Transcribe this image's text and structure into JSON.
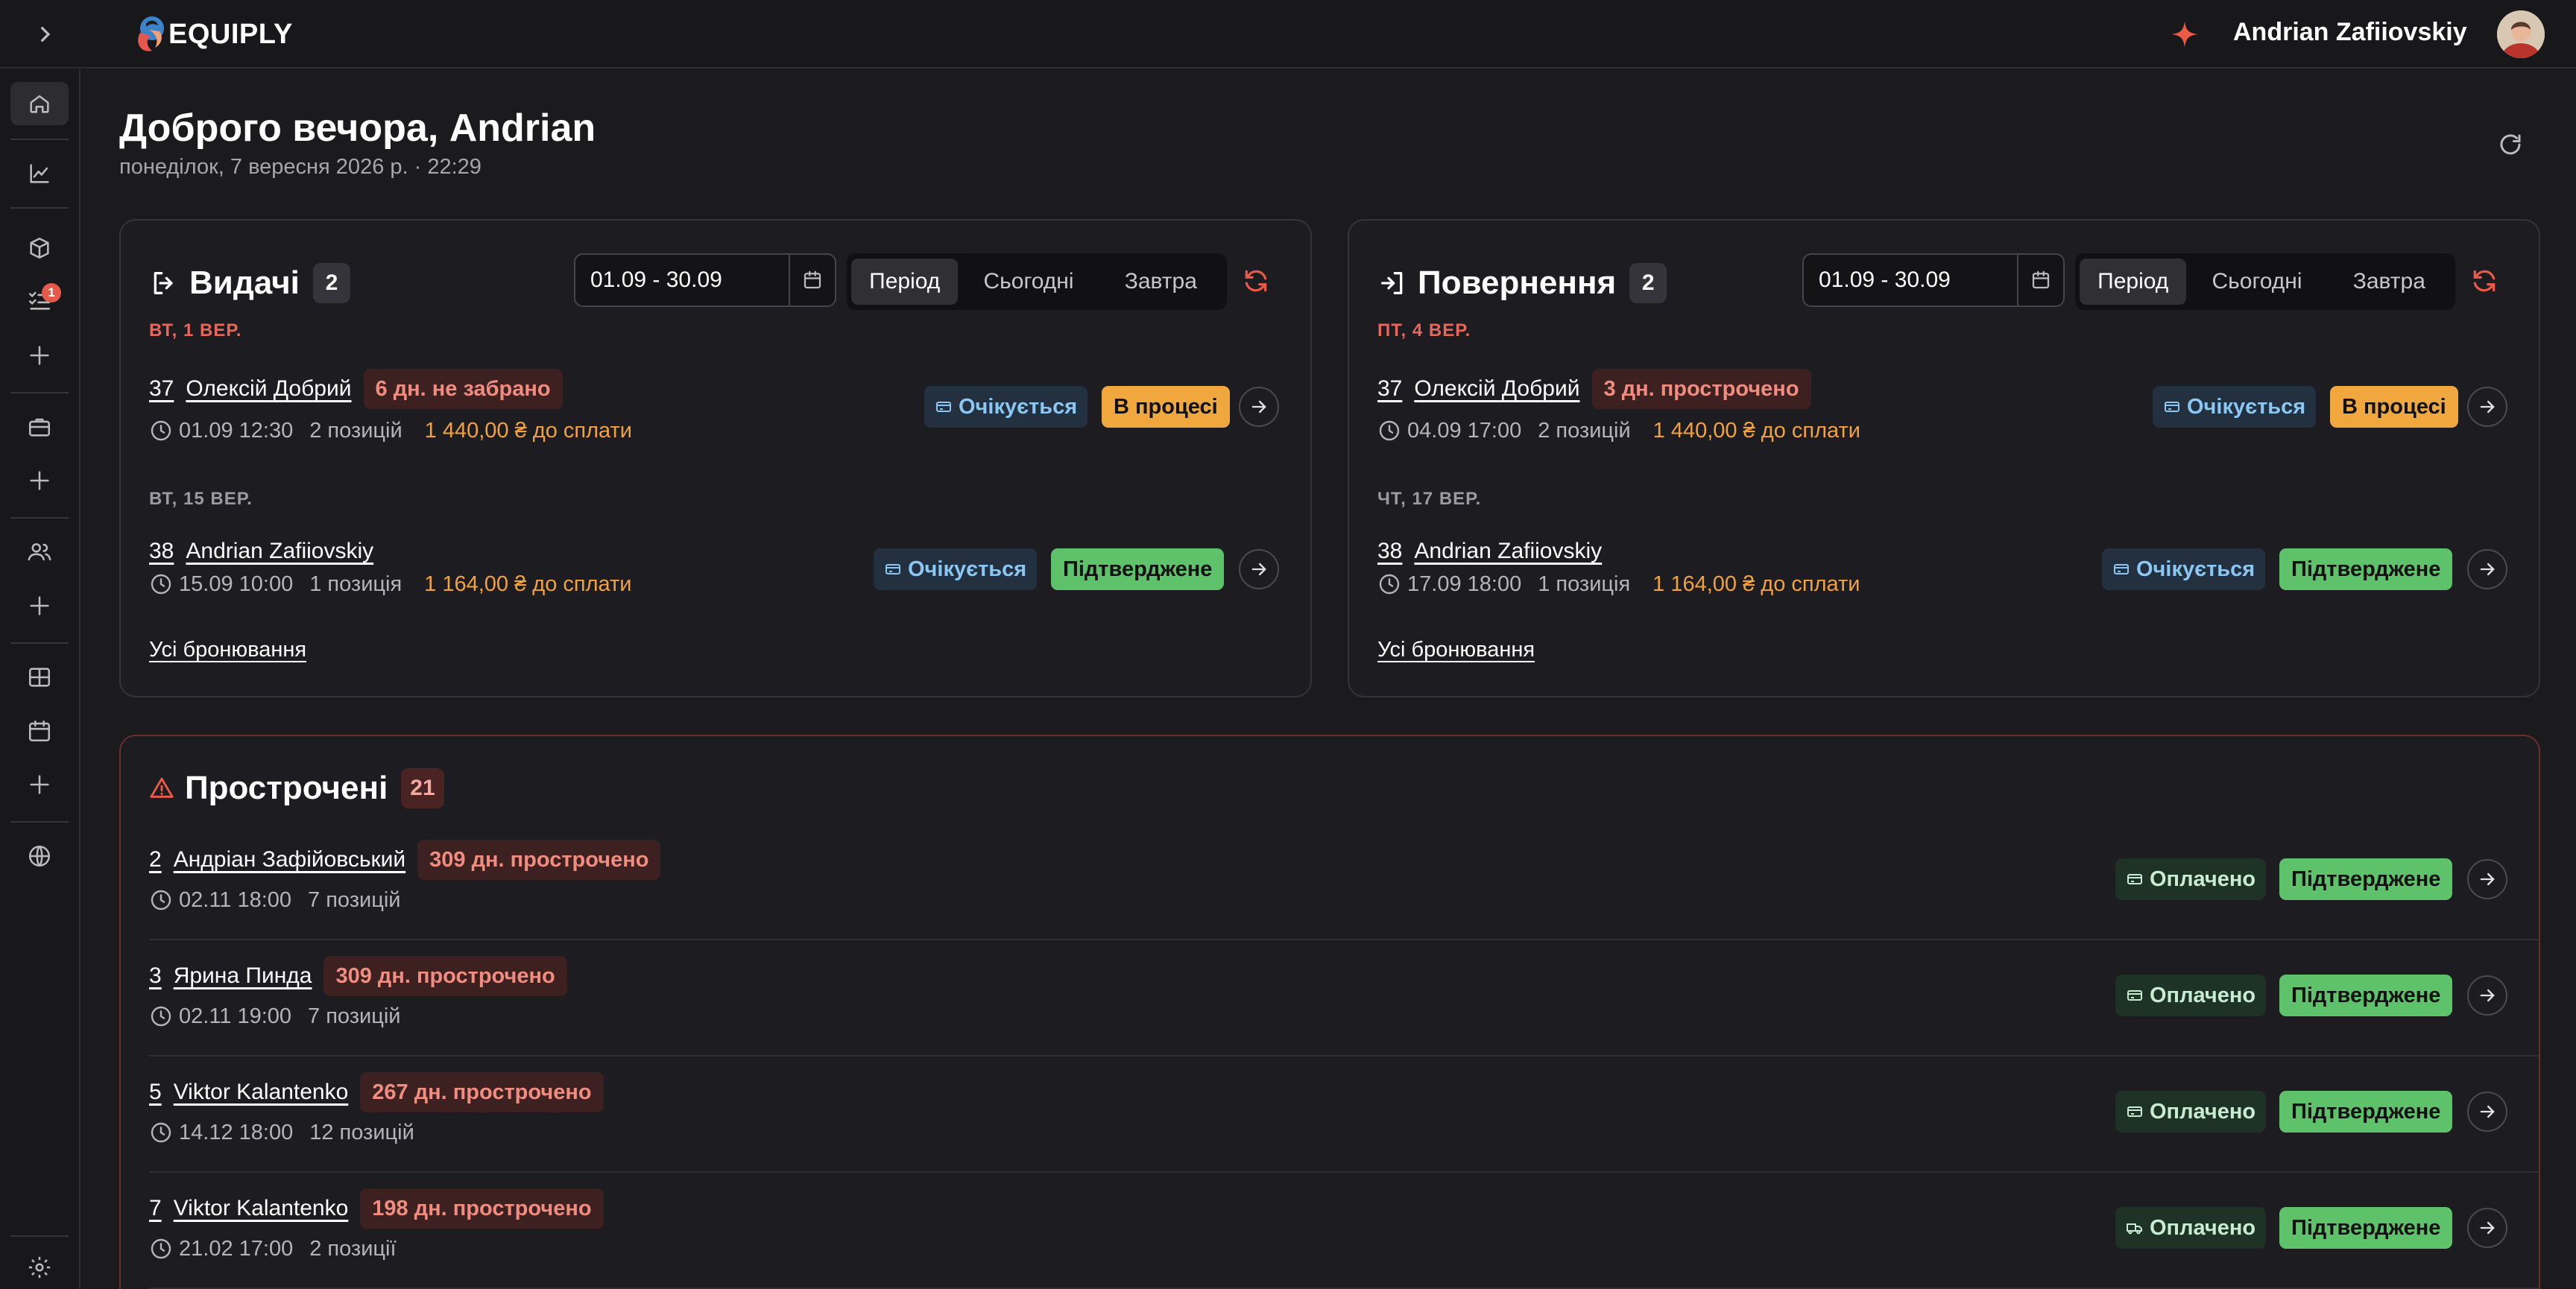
{
  "app": {
    "brand": "EQUIPLY"
  },
  "header": {
    "user_name": "Andrian Zafiiovskiy"
  },
  "sidebar": {
    "tasks_badge": "1"
  },
  "page": {
    "greeting": "Доброго вечора, Andrian",
    "date_line": "понеділок, 7 вересня 2026 р. · 22:29"
  },
  "segments": [
    "Період",
    "Сьогодні",
    "Завтра"
  ],
  "issues": {
    "title": "Видачі",
    "count": "2",
    "date_range": "01.09 - 30.09",
    "all_link": "Усі бронювання",
    "groups": [
      {
        "day": "ВТ, 1 ВЕР.",
        "day_color": "red",
        "booking": {
          "number": "37",
          "customer": "Олексій Добрий",
          "warning": "6 дн. не забрано",
          "time": "01.09 12:30",
          "positions": "2 позицій",
          "due": "1 440,00 ₴ до сплати",
          "payment": "Очікується",
          "status": "В процесі"
        }
      },
      {
        "day": "ВТ, 15 ВЕР.",
        "day_color": "gray",
        "booking": {
          "number": "38",
          "customer": "Andrian Zafiiovskiy",
          "warning": "",
          "time": "15.09 10:00",
          "positions": "1 позиція",
          "due": "1 164,00 ₴ до сплати",
          "payment": "Очікується",
          "status": "Підтверджене"
        }
      }
    ]
  },
  "returns": {
    "title": "Повернення",
    "count": "2",
    "date_range": "01.09 - 30.09",
    "all_link": "Усі бронювання",
    "groups": [
      {
        "day": "ПТ, 4 ВЕР.",
        "day_color": "red",
        "booking": {
          "number": "37",
          "customer": "Олексій Добрий",
          "warning": "3 дн. прострочено",
          "time": "04.09 17:00",
          "positions": "2 позицій",
          "due": "1 440,00 ₴ до сплати",
          "payment": "Очікується",
          "status": "В процесі"
        }
      },
      {
        "day": "ЧТ, 17 ВЕР.",
        "day_color": "gray",
        "booking": {
          "number": "38",
          "customer": "Andrian Zafiiovskiy",
          "warning": "",
          "time": "17.09 18:00",
          "positions": "1 позиція",
          "due": "1 164,00 ₴ до сплати",
          "payment": "Очікується",
          "status": "Підтверджене"
        }
      }
    ]
  },
  "overdue": {
    "title": "Прострочені",
    "count": "21",
    "rows": [
      {
        "number": "2",
        "customer": "Андріан Зафійовський",
        "warning": "309 дн. прострочено",
        "time": "02.11 18:00",
        "positions": "7 позицій",
        "payment": "Оплачено",
        "payment_icon": "card-icon",
        "status": "Підтверджене"
      },
      {
        "number": "3",
        "customer": "Ярина Пинда",
        "warning": "309 дн. прострочено",
        "time": "02.11 19:00",
        "positions": "7 позицій",
        "payment": "Оплачено",
        "payment_icon": "card-icon",
        "status": "Підтверджене"
      },
      {
        "number": "5",
        "customer": "Viktor Kalantenko",
        "warning": "267 дн. прострочено",
        "time": "14.12 18:00",
        "positions": "12 позицій",
        "payment": "Оплачено",
        "payment_icon": "card-icon",
        "status": "Підтверджене"
      },
      {
        "number": "7",
        "customer": "Viktor Kalantenko",
        "warning": "198 дн. прострочено",
        "time": "21.02 17:00",
        "positions": "2 позиції",
        "payment": "Оплачено",
        "payment_icon": "truck-icon",
        "status": "Підтверджене"
      }
    ]
  }
}
